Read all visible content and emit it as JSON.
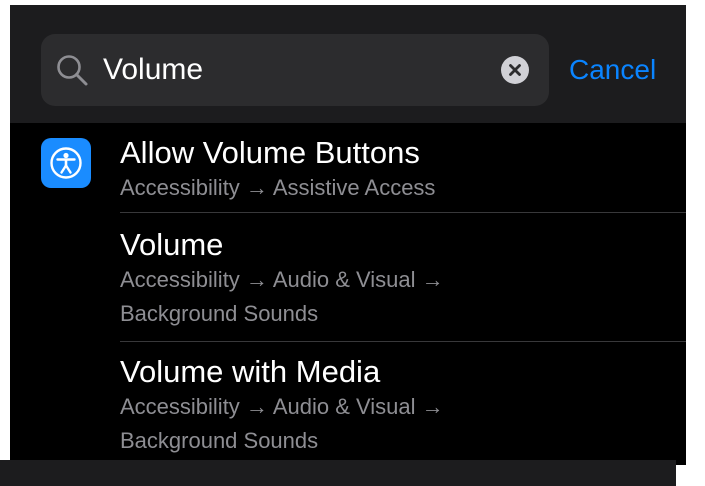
{
  "search": {
    "query": "Volume",
    "cancel_label": "Cancel"
  },
  "results": [
    {
      "title": "Allow Volume Buttons",
      "path": "Accessibility → Assistive Access",
      "icon": "accessibility-icon"
    },
    {
      "title": "Volume",
      "path": "Accessibility → Audio & Visual → Background Sounds"
    },
    {
      "title": "Volume with Media",
      "path": "Accessibility → Audio & Visual → Background Sounds"
    }
  ],
  "colors": {
    "background": "#000000",
    "search_bar": "#1c1c1e",
    "search_field": "#2c2c2e",
    "accent": "#0a84ff",
    "accessibility_icon": "#1a8cff",
    "secondary_text": "#8e8e93"
  }
}
